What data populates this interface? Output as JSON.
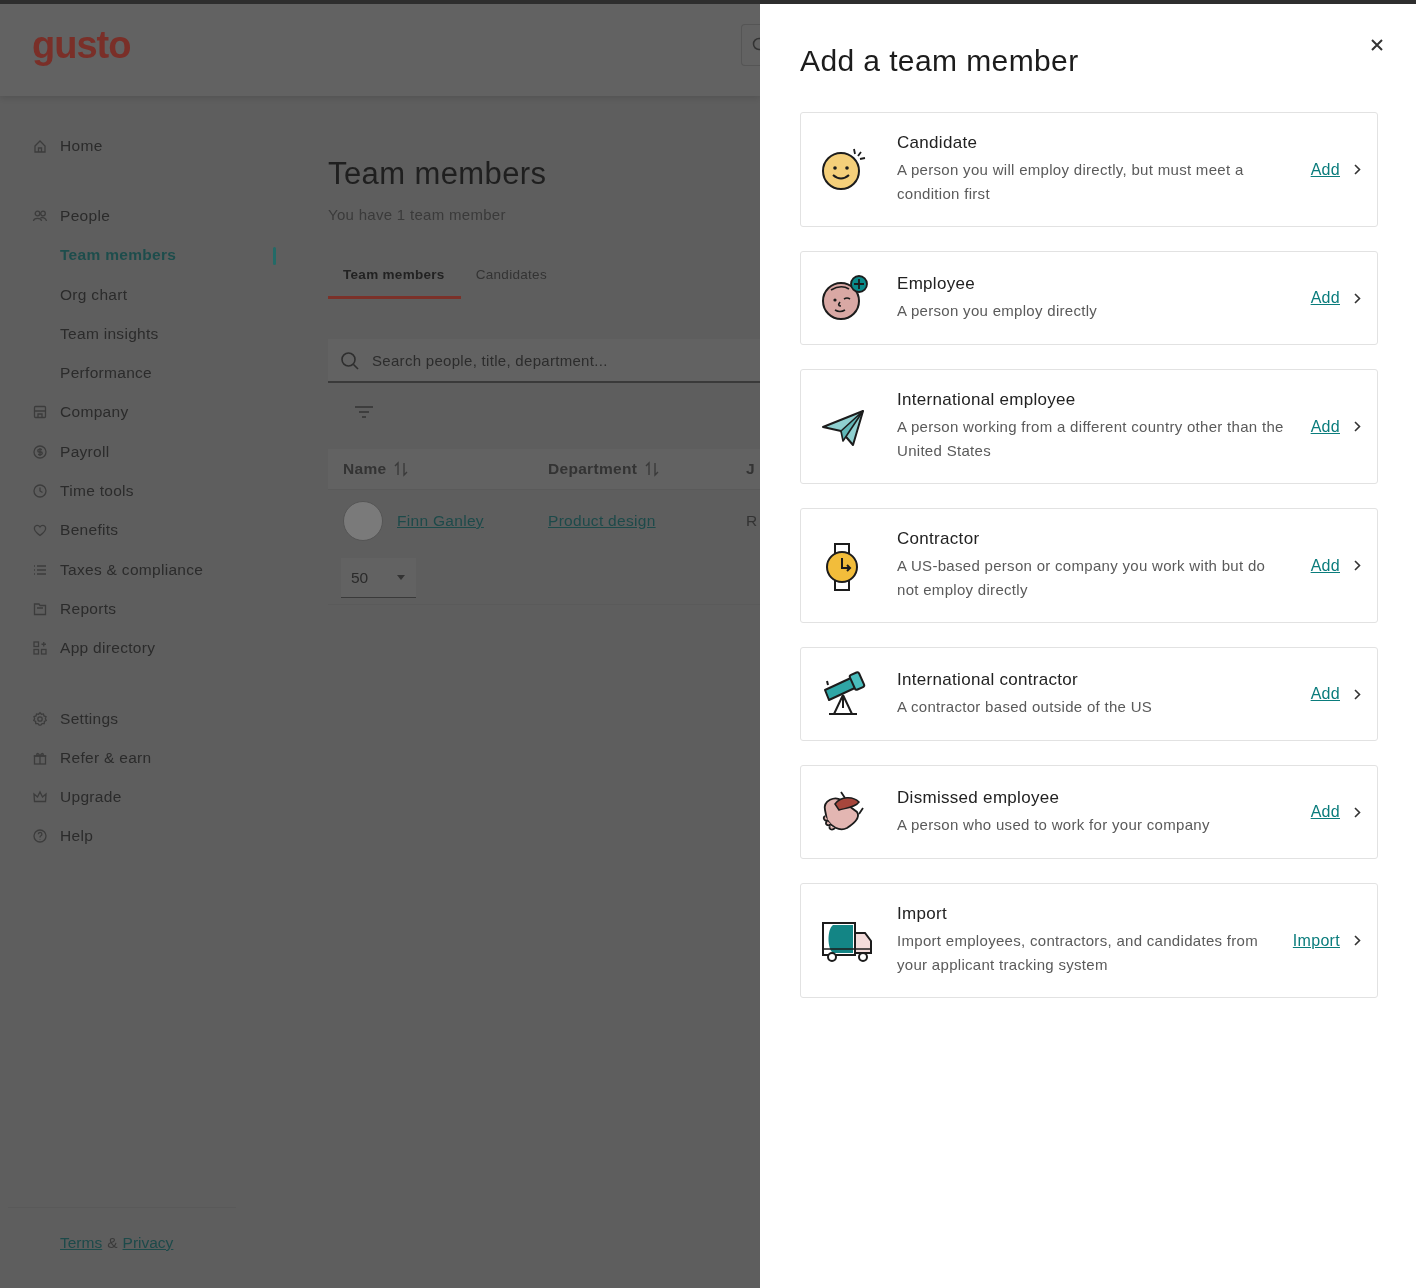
{
  "app": {
    "logo": "gusto"
  },
  "sidebar": {
    "sections": [
      {
        "items": [
          {
            "label": "Home",
            "selected": false
          }
        ]
      },
      {
        "items": [
          {
            "label": "People",
            "selected": false,
            "children": [
              {
                "label": "Team members",
                "selected": true
              },
              {
                "label": "Org chart",
                "selected": false
              },
              {
                "label": "Team insights",
                "selected": false
              },
              {
                "label": "Performance",
                "selected": false
              }
            ]
          },
          {
            "label": "Company",
            "selected": false
          },
          {
            "label": "Payroll",
            "selected": false
          },
          {
            "label": "Time tools",
            "selected": false
          },
          {
            "label": "Benefits",
            "selected": false
          },
          {
            "label": "Taxes & compliance",
            "selected": false
          },
          {
            "label": "Reports",
            "selected": false
          },
          {
            "label": "App directory",
            "selected": false
          }
        ]
      },
      {
        "items": [
          {
            "label": "Settings",
            "selected": false
          },
          {
            "label": "Refer & earn",
            "selected": false
          },
          {
            "label": "Upgrade",
            "selected": false
          },
          {
            "label": "Help",
            "selected": false
          }
        ]
      }
    ],
    "footer": {
      "terms": "Terms",
      "separator": "&",
      "privacy": "Privacy"
    }
  },
  "page": {
    "title": "Team members",
    "subtitle": "You have 1 team member",
    "tabs": [
      {
        "label": "Team members",
        "selected": true
      },
      {
        "label": "Candidates",
        "selected": false
      }
    ],
    "search": {
      "placeholder": "Search people, title, department..."
    },
    "table": {
      "columns": [
        {
          "label": "Name",
          "sortable": true
        },
        {
          "label": "Department",
          "sortable": true
        },
        {
          "label": "J"
        }
      ],
      "rows": [
        {
          "name": "Finn Ganley",
          "department": "Product design",
          "column_3": "R"
        }
      ]
    },
    "page_size": "50"
  },
  "drawer": {
    "title": "Add a team member",
    "options": [
      {
        "title": "Candidate",
        "description": "A person you will employ directly, but must meet a condition first",
        "action": "Add"
      },
      {
        "title": "Employee",
        "description": "A person you employ directly",
        "action": "Add"
      },
      {
        "title": "International employee",
        "description": "A person working from a different country other than the United States",
        "action": "Add"
      },
      {
        "title": "Contractor",
        "description": "A US-based person or company you work with but do not employ directly",
        "action": "Add"
      },
      {
        "title": "International contractor",
        "description": "A contractor based outside of the US",
        "action": "Add"
      },
      {
        "title": "Dismissed employee",
        "description": "A person who used to work for your company",
        "action": "Add"
      },
      {
        "title": "Import",
        "description": "Import employees, contractors, and candidates from your applicant tracking system",
        "action": "Import"
      }
    ]
  }
}
